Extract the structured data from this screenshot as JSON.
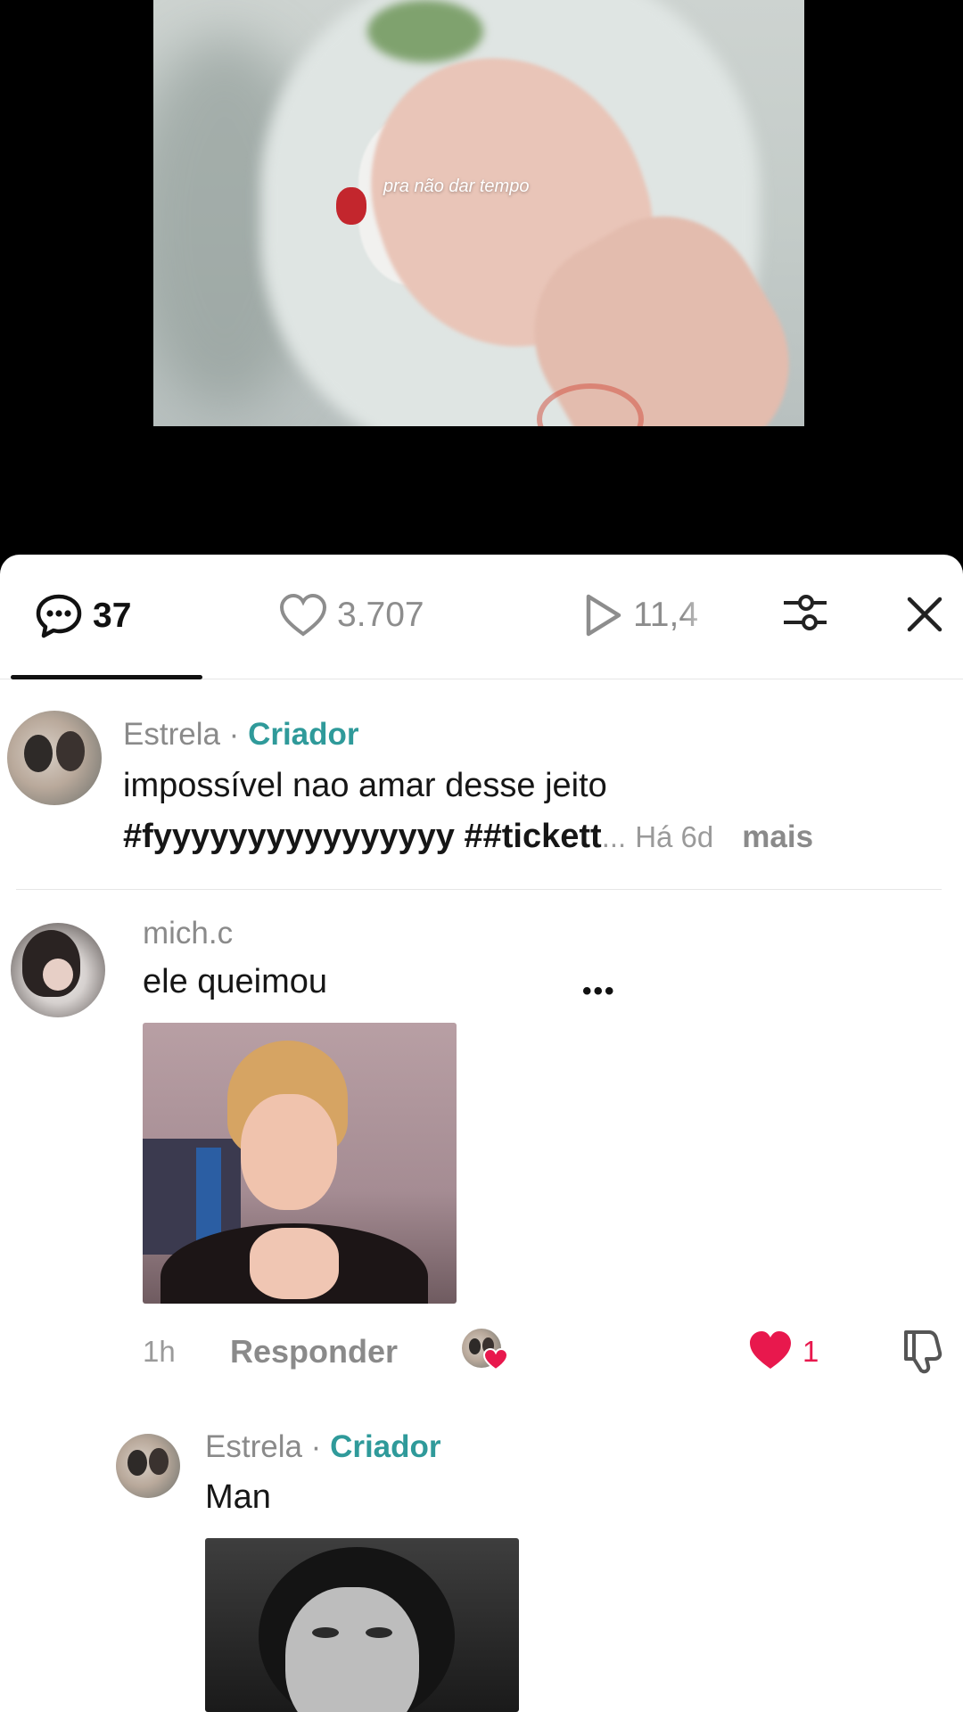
{
  "video": {
    "caption": "pra não dar tempo"
  },
  "tabs": {
    "comments_count": "37",
    "likes_count": "3.707",
    "views_count": "11,4"
  },
  "creator_post": {
    "author": "Estrela",
    "separator": "·",
    "creator_label": "Criador",
    "text": "impossível nao amar desse jeito",
    "hashtags": "#fyyyyyyyyyyyyyyyy ##tickett",
    "ellipsis": "...",
    "time": "Há 6d",
    "more_label": "mais"
  },
  "comments": [
    {
      "author": "mich.c",
      "text": "ele queimou",
      "time": "1h",
      "reply_label": "Responder",
      "like_count": "1",
      "more_menu": "•••"
    }
  ],
  "reply": {
    "author": "Estrela",
    "separator": "·",
    "creator_label": "Criador",
    "text": "Man"
  },
  "colors": {
    "creator_accent": "#2f9a9a",
    "like_red": "#e8184d",
    "text_primary": "#161616",
    "text_secondary": "#8a8a8a"
  },
  "icons": {
    "comments_tab": "chat-bubble-icon",
    "likes_tab": "heart-outline-icon",
    "views_tab": "play-icon",
    "filter": "sliders-icon",
    "close": "close-icon",
    "like": "heart-filled-icon",
    "dislike": "thumbs-down-icon"
  }
}
